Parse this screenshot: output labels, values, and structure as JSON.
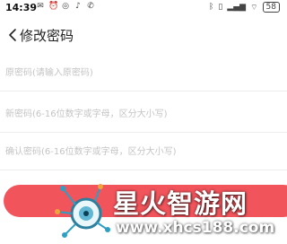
{
  "status_bar": {
    "time": "14:39",
    "battery": "58",
    "icons": [
      "message-icon",
      "alarm-icon",
      "location-icon",
      "tiktok-icon",
      "wifi-call-icon",
      "bluetooth-icon",
      "vibrate-icon",
      "signal-icon",
      "wifi-icon"
    ]
  },
  "header": {
    "title": "修改密码"
  },
  "form": {
    "old_password_placeholder": "原密码(请输入原密码)",
    "new_password_placeholder": "新密码(6-16位数字或字母，区分大小写)",
    "confirm_password_placeholder": "确认密码(6-16位数字或字母，区分大小写)"
  },
  "colors": {
    "accent": "#f2545b",
    "divider": "#ededed",
    "placeholder": "#c4c4c4"
  },
  "watermark": {
    "title": "星火智游网",
    "url": "www.xhcs188.com"
  }
}
